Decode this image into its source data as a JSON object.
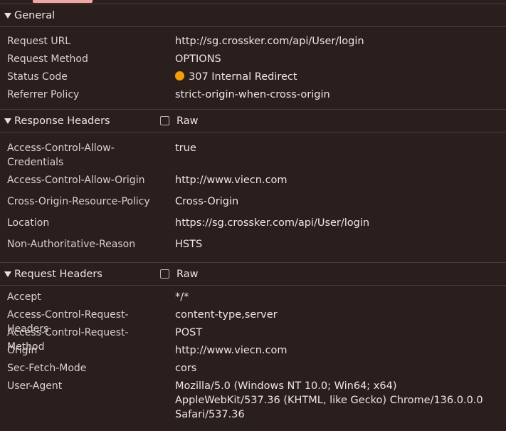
{
  "general": {
    "title": "General",
    "rows": [
      {
        "key": "Request URL",
        "value": "http://sg.crossker.com/api/User/login"
      },
      {
        "key": "Request Method",
        "value": "OPTIONS"
      },
      {
        "key": "Status Code",
        "value": "307 Internal Redirect"
      },
      {
        "key": "Referrer Policy",
        "value": "strict-origin-when-cross-origin"
      }
    ]
  },
  "response_headers": {
    "title": "Response Headers",
    "raw_label": "Raw",
    "rows": [
      {
        "key": "Access-Control-Allow-Credentials",
        "value": "true"
      },
      {
        "key": "Access-Control-Allow-Origin",
        "value": "http://www.viecn.com"
      },
      {
        "key": "Cross-Origin-Resource-Policy",
        "value": "Cross-Origin"
      },
      {
        "key": "Location",
        "value": "https://sg.crossker.com/api/User/login"
      },
      {
        "key": "Non-Authoritative-Reason",
        "value": "HSTS"
      }
    ]
  },
  "request_headers": {
    "title": "Request Headers",
    "raw_label": "Raw",
    "rows": [
      {
        "key": "Accept",
        "value": "*/*"
      },
      {
        "key": "Access-Control-Request-Headers",
        "value": "content-type,server"
      },
      {
        "key": "Access-Control-Request-Method",
        "value": "POST"
      },
      {
        "key": "Origin",
        "value": "http://www.viecn.com"
      },
      {
        "key": "Sec-Fetch-Mode",
        "value": "cors"
      },
      {
        "key": "User-Agent",
        "value": "Mozilla/5.0 (Windows NT 10.0; Win64; x64) AppleWebKit/537.36 (KHTML, like Gecko) Chrome/136.0.0.0 Safari/537.36"
      }
    ]
  },
  "colors": {
    "background": "#2b1f1e",
    "divider": "#4a3c3a",
    "status_warning": "#f29d0c",
    "tab_accent": "#f0a7a2"
  },
  "icons": {
    "section_toggle": "triangle-down-icon",
    "status": "status-dot-icon"
  }
}
